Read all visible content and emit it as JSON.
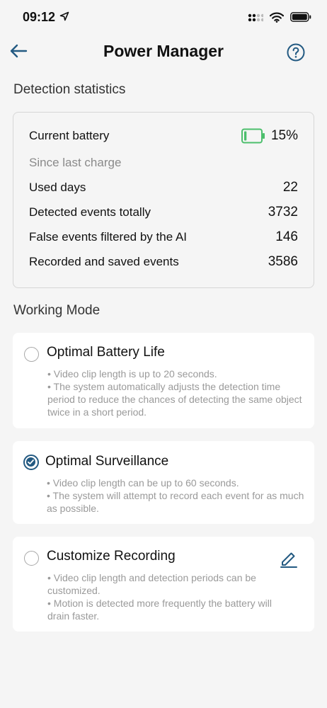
{
  "status": {
    "time": "09:12"
  },
  "nav": {
    "title": "Power Manager"
  },
  "stats": {
    "section_title": "Detection statistics",
    "battery_label": "Current battery",
    "battery_value": "15%",
    "battery_level": 0.15,
    "since_label": "Since last charge",
    "rows": [
      {
        "label": "Used days",
        "value": "22"
      },
      {
        "label": "Detected events totally",
        "value": "3732"
      },
      {
        "label": "False events filtered by the AI",
        "value": "146"
      },
      {
        "label": "Recorded and saved events",
        "value": "3586"
      }
    ]
  },
  "working_mode": {
    "section_title": "Working Mode",
    "modes": [
      {
        "title": "Optimal Battery Life",
        "selected": false,
        "lines": [
          "• Video clip length is up to 20 seconds.",
          "• The system automatically adjusts the detection time period to reduce the chances of detecting the same object twice in a short period."
        ]
      },
      {
        "title": "Optimal Surveillance",
        "selected": true,
        "lines": [
          "• Video clip length can be up to 60 seconds.",
          "• The system will attempt to record each event for as much as possible."
        ]
      },
      {
        "title": "Customize Recording",
        "selected": false,
        "lines": [
          "• Video clip length and detection periods can be customized.",
          "• Motion is detected more frequently the battery will drain faster."
        ]
      }
    ]
  },
  "colors": {
    "accent": "#235a82",
    "battery": "#4cbe6c",
    "card_bg": "#ffffff",
    "page_bg": "#f5f5f5"
  },
  "icons": [
    "location-arrow-icon",
    "signal-icon",
    "wifi-icon",
    "battery-status-icon",
    "back-arrow-icon",
    "help-icon",
    "battery-icon",
    "edit-pencil-icon"
  ]
}
